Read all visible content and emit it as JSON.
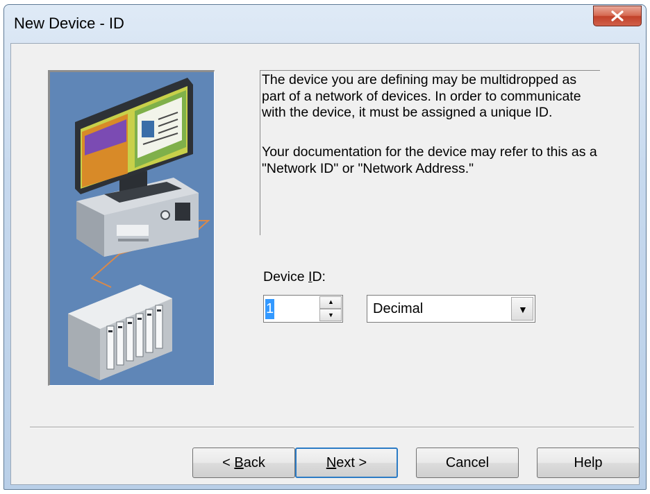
{
  "window": {
    "title": "New Device - ID"
  },
  "description": {
    "paragraph1": "The device you are defining may be multidropped as part of a network of devices.  In order to communicate with the device, it must be assigned a unique ID.",
    "paragraph2": "Your documentation for the device may refer to this as a \"Network ID\" or \"Network Address.\""
  },
  "device_id": {
    "label_prefix": "Device ",
    "label_accel": "I",
    "label_suffix": "D:",
    "value": "1",
    "format": "Decimal"
  },
  "buttons": {
    "back": {
      "prefix": "< ",
      "accel": "B",
      "rest": "ack"
    },
    "next": {
      "accel": "N",
      "rest": "ext >"
    },
    "cancel": "Cancel",
    "help": "Help"
  },
  "colors": {
    "illustration_bg": "#5f86b7",
    "selection": "#3399ff",
    "close_button": "#c9503a",
    "default_button_border": "#2b7bc5"
  },
  "icons": [
    "close-icon",
    "spin-up-icon",
    "spin-down-icon",
    "dropdown-arrow-icon",
    "computer-plc-network-illustration"
  ]
}
